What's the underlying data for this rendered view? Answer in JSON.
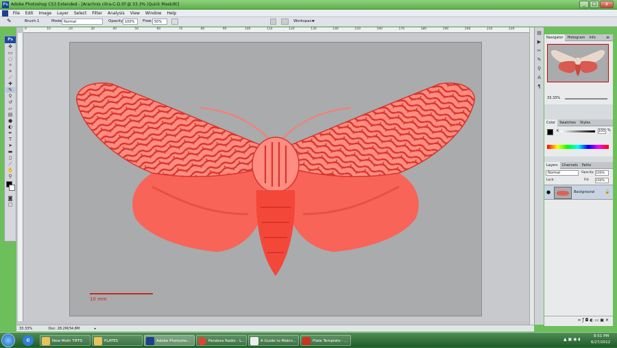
{
  "window": {
    "title": "Adobe Photoshop CS3 Extended - [Arachnis citra-C-D.tif @ 33.3% (Quick Mask/8)]",
    "controls": [
      "_",
      "□",
      "x"
    ]
  },
  "menu": [
    "File",
    "Edit",
    "Image",
    "Layer",
    "Select",
    "Filter",
    "Analysis",
    "View",
    "Window",
    "Help"
  ],
  "options": {
    "brush_label": "Brush:",
    "brush_size": "1",
    "mode_label": "Mode:",
    "mode_value": "Normal",
    "opacity_label": "Opacity:",
    "opacity_value": "100%",
    "flow_label": "Flow:",
    "flow_value": "50%",
    "workspace_label": "Workspace"
  },
  "ruler": {
    "top": [
      "0",
      "10",
      "20",
      "30",
      "40",
      "50",
      "60",
      "70",
      "80",
      "90",
      "100",
      "110",
      "120",
      "130",
      "140",
      "150",
      "160",
      "170",
      "180",
      "190",
      "200",
      "210",
      "220"
    ]
  },
  "image": {
    "scale_label": "10 mm",
    "moth_color": "#ff7a6e",
    "pattern_color": "#d8342a",
    "bg_color": "#a9abad"
  },
  "status": {
    "zoom": "33.33%",
    "doc": "Doc: 28.2M/34.8M"
  },
  "panels": {
    "navigator_tabs": [
      "Navigator",
      "Histogram",
      "Info"
    ],
    "navigator_zoom": "33.33%",
    "color_tabs": [
      "Color",
      "Swatches",
      "Styles"
    ],
    "color_k_label": "K",
    "color_k_value": "100",
    "color_k_unit": "%",
    "layers_tabs": [
      "Layers",
      "Channels",
      "Paths"
    ],
    "blend_mode": "Normal",
    "opacity_label": "Opacity:",
    "opacity_value": "100%",
    "lock_label": "Lock:",
    "fill_label": "Fill:",
    "fill_value": "100%",
    "layer_name": "Background"
  },
  "taskbar": {
    "items": [
      {
        "label": "New Moth TIFFS",
        "icon_color": "#e8c25a"
      },
      {
        "label": "PLATES",
        "icon_color": "#e8c25a"
      },
      {
        "label": "Adobe Photosho...",
        "icon_color": "#1d3f8c"
      },
      {
        "label": "Pandora Radio - L...",
        "icon_color": "#dd4433"
      },
      {
        "label": "A Guide to Makin...",
        "icon_color": "#eeeeee"
      },
      {
        "label": "Plate Template - ...",
        "icon_color": "#cc3322"
      }
    ],
    "time": "8:51 PM",
    "date": "6/27/2012"
  }
}
